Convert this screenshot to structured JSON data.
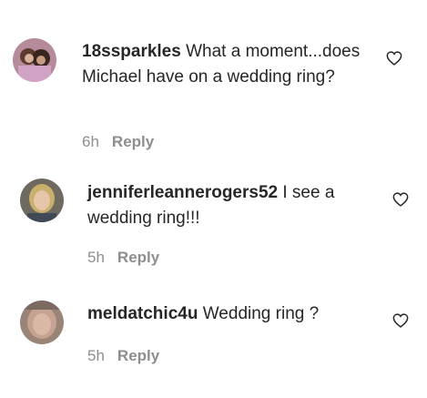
{
  "comments": [
    {
      "username": "18ssparkles",
      "text": " What a moment...does Michael have on a wedding ring?",
      "time": "6h",
      "reply_label": "Reply",
      "avatar_icon": "user-avatar-photo",
      "like_icon": "heart-outline-icon"
    },
    {
      "username": "jenniferleannerogers52",
      "text": " I see a wedding ring!!!",
      "time": "5h",
      "reply_label": "Reply",
      "avatar_icon": "user-avatar-photo",
      "like_icon": "heart-outline-icon"
    },
    {
      "username": "meldatchic4u",
      "text": " Wedding ring ?",
      "time": "5h",
      "reply_label": "Reply",
      "avatar_icon": "user-avatar-photo",
      "like_icon": "heart-outline-icon"
    }
  ]
}
